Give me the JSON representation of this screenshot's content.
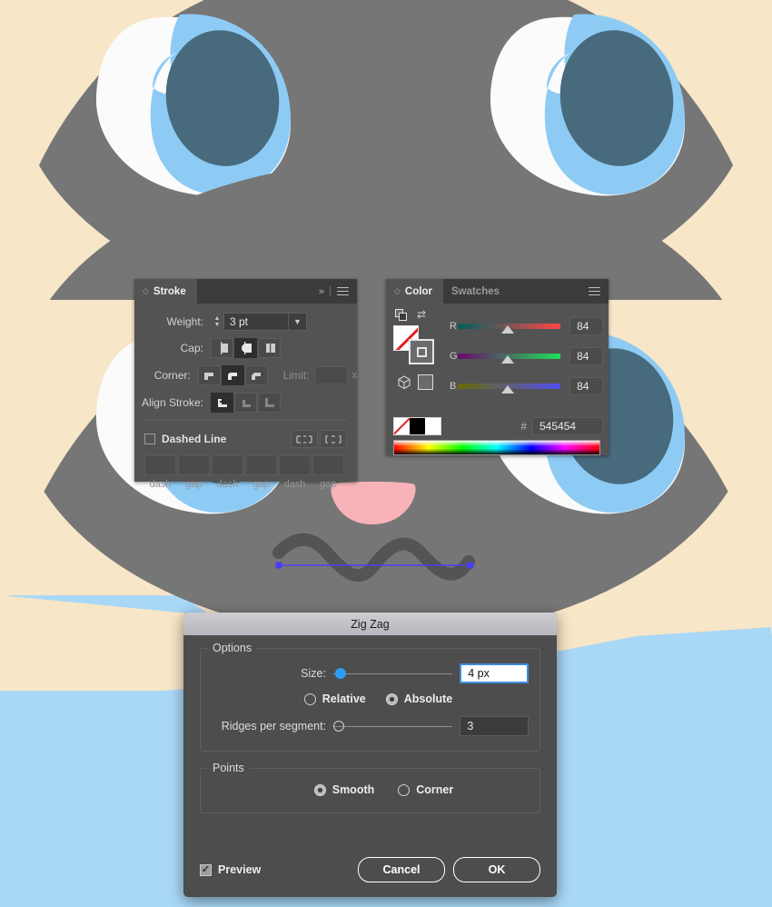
{
  "artboard": {
    "description": "Adobe Illustrator artboard with two cartoon koala face illustrations",
    "colors": {
      "background_cream": "#f7e6c8",
      "sky_blue": "#a9d8f7",
      "light_blue": "#8dcbf4",
      "face_gray": "#767676",
      "eye_dark": "#486a7d",
      "eye_white": "#fbfbfb",
      "nose_pink": "#f7b3b8",
      "stroke_dark": "#545454",
      "selection_blue": "#4a3ff0"
    },
    "top_path_label": "straight-line-path",
    "bottom_path_label": "zigzag-wave-path"
  },
  "stroke_panel": {
    "tabs": [
      {
        "label": "Stroke",
        "active": true
      }
    ],
    "collapse_icon": "chevron-double-right-icon",
    "menu_icon": "panel-menu-icon",
    "weight": {
      "label": "Weight:",
      "value": "3 pt"
    },
    "cap": {
      "label": "Cap:",
      "options": [
        "butt-cap",
        "round-cap",
        "projecting-cap"
      ],
      "selected": 1
    },
    "corner": {
      "label": "Corner:",
      "options": [
        "miter-join",
        "round-join",
        "bevel-join"
      ],
      "selected": 1
    },
    "limit": {
      "label": "Limit:",
      "value": "",
      "unit": "x"
    },
    "align_stroke": {
      "label": "Align Stroke:",
      "options": [
        "align-center",
        "align-inside",
        "align-outside"
      ],
      "selected": 0
    },
    "dashed_line": {
      "label": "Dashed Line",
      "checked": false
    },
    "dash_buttons": [
      "preserve-exact-dash",
      "align-dashes-to-corners"
    ],
    "dash_fields": [
      {
        "name": "dash",
        "value": ""
      },
      {
        "name": "gap",
        "value": ""
      },
      {
        "name": "dash",
        "value": ""
      },
      {
        "name": "gap",
        "value": ""
      },
      {
        "name": "dash",
        "value": ""
      },
      {
        "name": "gap",
        "value": ""
      }
    ]
  },
  "color_panel": {
    "tabs": [
      {
        "label": "Color",
        "active": true
      },
      {
        "label": "Swatches",
        "active": false
      }
    ],
    "menu_icon": "panel-menu-icon",
    "mode": "RGB",
    "channels": [
      {
        "label": "R",
        "value": "84"
      },
      {
        "label": "G",
        "value": "84"
      },
      {
        "label": "B",
        "value": "84"
      }
    ],
    "hex": {
      "prefix": "#",
      "value": "545454"
    },
    "fill_stroke": {
      "fill": "none",
      "stroke": "#545454"
    },
    "quick_swatches": [
      "none",
      "black",
      "white"
    ]
  },
  "zigzag_dialog": {
    "title": "Zig Zag",
    "options_legend": "Options",
    "size": {
      "label": "Size:",
      "value": "4 px",
      "slider_percent": 4
    },
    "mode": {
      "options": [
        "Relative",
        "Absolute"
      ],
      "selected": "Absolute"
    },
    "ridges": {
      "label": "Ridges per segment:",
      "value": "3",
      "slider_percent": 2
    },
    "points_legend": "Points",
    "points": {
      "options": [
        "Smooth",
        "Corner"
      ],
      "selected": "Smooth"
    },
    "preview": {
      "label": "Preview",
      "checked": true,
      "mark": "✓"
    },
    "buttons": {
      "cancel": "Cancel",
      "ok": "OK"
    }
  }
}
